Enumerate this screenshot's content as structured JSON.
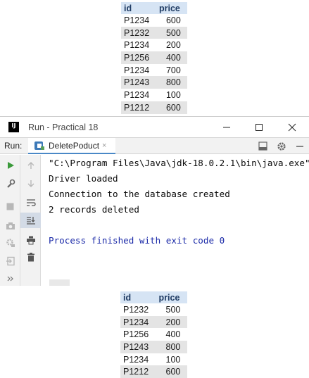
{
  "top_table": {
    "headers": [
      "id",
      "price"
    ],
    "rows": [
      [
        "P1234",
        "600"
      ],
      [
        "P1232",
        "500"
      ],
      [
        "P1234",
        "200"
      ],
      [
        "P1256",
        "400"
      ],
      [
        "P1234",
        "700"
      ],
      [
        "P1243",
        "800"
      ],
      [
        "P1234",
        "100"
      ],
      [
        "P1212",
        "600"
      ]
    ]
  },
  "window": {
    "title": "Run - Practical 18",
    "app_icon_text": "IJ"
  },
  "toolbar": {
    "run_label": "Run:",
    "tab_label": "DeletePoduct",
    "tab_close": "×"
  },
  "console": {
    "lines": [
      "\"C:\\Program Files\\Java\\jdk-18.0.2.1\\bin\\java.exe\"",
      "Driver loaded",
      "Connection to the database created",
      "2 records deleted",
      "",
      "Process finished with exit code 0"
    ]
  },
  "bottom_table": {
    "headers": [
      "id",
      "price"
    ],
    "rows": [
      [
        "P1232",
        "500"
      ],
      [
        "P1234",
        "200"
      ],
      [
        "P1256",
        "400"
      ],
      [
        "P1243",
        "800"
      ],
      [
        "P1234",
        "100"
      ],
      [
        "P1212",
        "600"
      ]
    ]
  },
  "colors": {
    "table_header": "#d6e4f4",
    "table_alt_row": "#e4e4e4",
    "run_green": "#3b9a3b",
    "console_blue": "#1b2aa8",
    "tab_underline": "#4a88c7"
  },
  "icons": [
    "intellij-icon",
    "minimize-icon",
    "maximize-icon",
    "close-icon",
    "java-class-icon",
    "layout-icon",
    "gear-icon",
    "hide-icon",
    "rerun-icon",
    "up-arrow-icon",
    "down-arrow-icon",
    "wrench-icon",
    "soft-wrap-icon",
    "stop-icon",
    "scroll-to-end-icon",
    "camera-icon",
    "print-icon",
    "settings-icon",
    "trash-icon",
    "exit-icon",
    "more-icon"
  ]
}
